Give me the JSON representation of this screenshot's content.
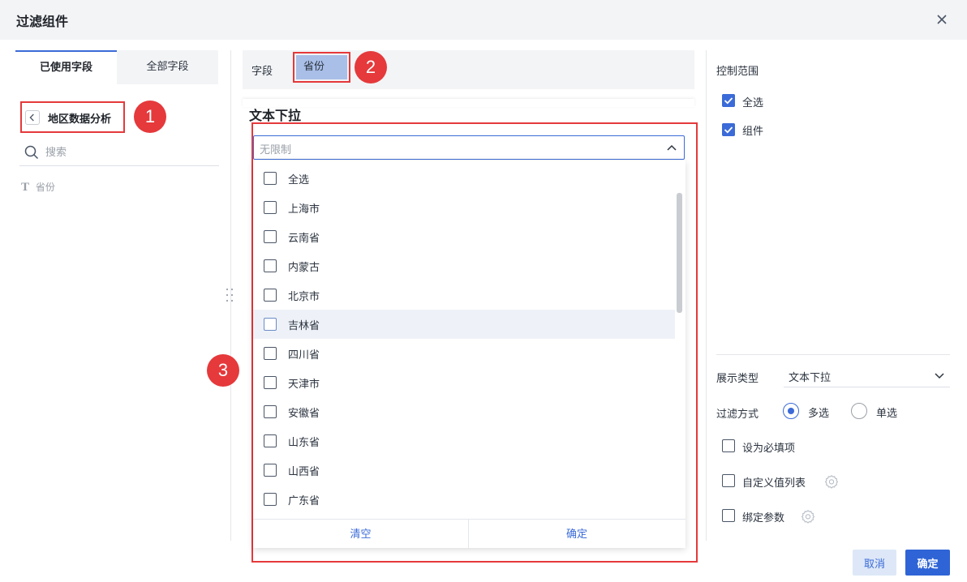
{
  "window": {
    "title": "过滤组件",
    "close_icon": "close-icon"
  },
  "left_panel": {
    "tabs": [
      {
        "label": "已使用字段",
        "active": true
      },
      {
        "label": "全部字段",
        "active": false
      }
    ],
    "back_label": "地区数据分析",
    "search": {
      "placeholder": "搜索",
      "value": ""
    },
    "fields": [
      {
        "type_icon": "T",
        "label": "省份"
      }
    ]
  },
  "annotations": {
    "badge1": "1",
    "badge2": "2",
    "badge3": "3",
    "color": "#e5393b"
  },
  "field_bar": {
    "label": "字段",
    "chip": "省份"
  },
  "preview": {
    "title": "文本下拉",
    "select_placeholder": "无限制",
    "options": [
      {
        "label": "全选",
        "checked": false
      },
      {
        "label": "上海市",
        "checked": false
      },
      {
        "label": "云南省",
        "checked": false
      },
      {
        "label": "内蒙古",
        "checked": false
      },
      {
        "label": "北京市",
        "checked": false
      },
      {
        "label": "吉林省",
        "checked": false,
        "hover": true
      },
      {
        "label": "四川省",
        "checked": false
      },
      {
        "label": "天津市",
        "checked": false
      },
      {
        "label": "安徽省",
        "checked": false
      },
      {
        "label": "山东省",
        "checked": false
      },
      {
        "label": "山西省",
        "checked": false
      },
      {
        "label": "广东省",
        "checked": false
      }
    ],
    "footer": {
      "clear": "清空",
      "confirm": "确定"
    }
  },
  "right_panel": {
    "scope_title": "控制范围",
    "scope": [
      {
        "label": "全选",
        "checked": true
      },
      {
        "label": "组件",
        "checked": true
      }
    ],
    "display_type_label": "展示类型",
    "display_type_value": "文本下拉",
    "filter_mode_label": "过滤方式",
    "filter_modes": [
      {
        "label": "多选",
        "selected": true
      },
      {
        "label": "单选",
        "selected": false
      }
    ],
    "options": [
      {
        "label": "设为必填项",
        "checked": false
      },
      {
        "label": "自定义值列表",
        "checked": false,
        "gear": true
      },
      {
        "label": "绑定参数",
        "checked": false,
        "gear": true
      }
    ]
  },
  "footer": {
    "cancel": "取消",
    "ok": "确定"
  },
  "colors": {
    "accent": "#3b6bd8",
    "primary_button": "#2f64d6",
    "chip_bg": "#a9bfe8",
    "highlight": "#e5393b"
  }
}
